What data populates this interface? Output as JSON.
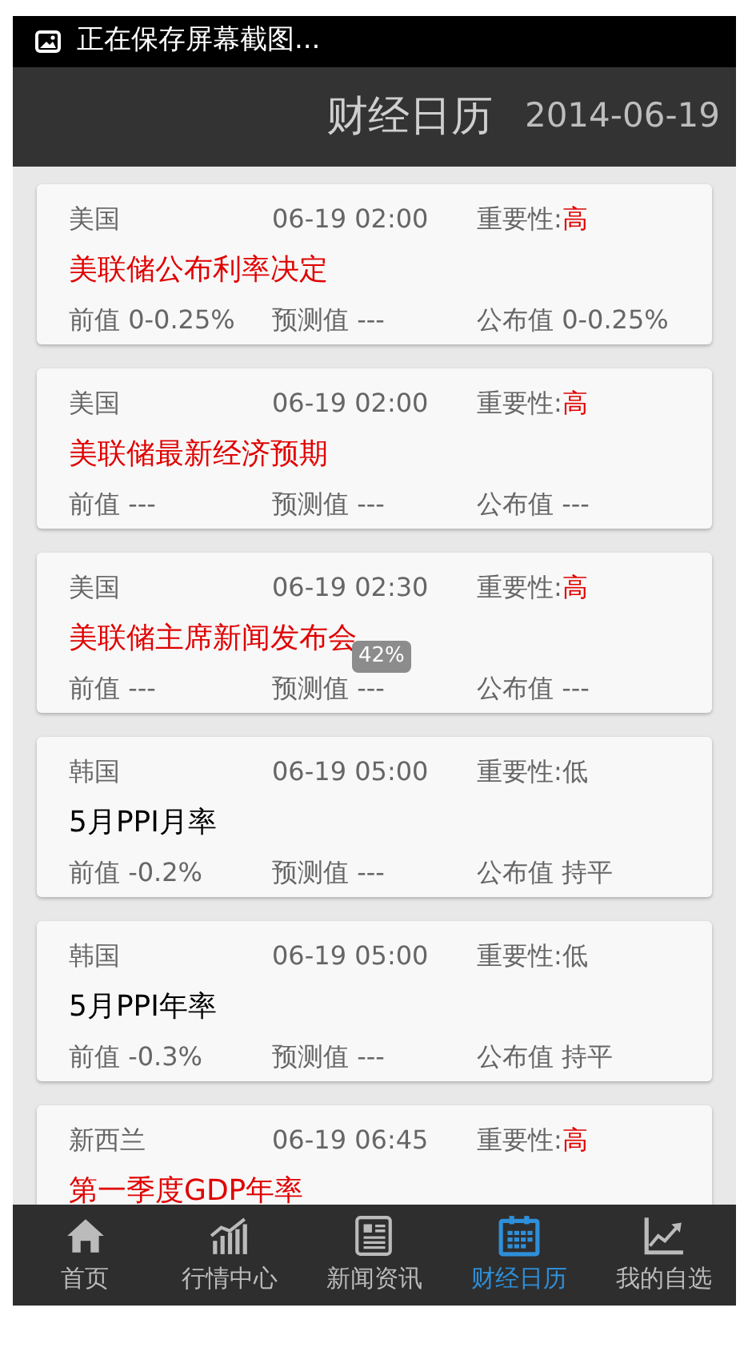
{
  "status_bar": {
    "notification": "正在保存屏幕截图..."
  },
  "header": {
    "title": "财经日历",
    "date": "2014-06-19"
  },
  "events": [
    {
      "country": "美国",
      "time": "06-19 02:00",
      "importance_label": "重要性:",
      "importance": "高",
      "high": true,
      "title": "美联储公布利率决定",
      "previous": "前值 0-0.25%",
      "forecast": "预测值 ---",
      "actual": "公布值 0-0.25%"
    },
    {
      "country": "美国",
      "time": "06-19 02:00",
      "importance_label": "重要性:",
      "importance": "高",
      "high": true,
      "title": "美联储最新经济预期",
      "previous": "前值 ---",
      "forecast": "预测值 ---",
      "actual": "公布值 ---"
    },
    {
      "country": "美国",
      "time": "06-19 02:30",
      "importance_label": "重要性:",
      "importance": "高",
      "high": true,
      "title": "美联储主席新闻发布会",
      "previous": "前值 ---",
      "forecast": "预测值 ---",
      "actual": "公布值 ---"
    },
    {
      "country": "韩国",
      "time": "06-19 05:00",
      "importance_label": "重要性:",
      "importance": "低",
      "high": false,
      "title": "5月PPI月率",
      "previous": "前值 -0.2%",
      "forecast": "预测值 ---",
      "actual": "公布值 持平"
    },
    {
      "country": "韩国",
      "time": "06-19 05:00",
      "importance_label": "重要性:",
      "importance": "低",
      "high": false,
      "title": "5月PPI年率",
      "previous": "前值 -0.3%",
      "forecast": "预测值 ---",
      "actual": "公布值 持平"
    },
    {
      "country": "新西兰",
      "time": "06-19 06:45",
      "importance_label": "重要性:",
      "importance": "高",
      "high": true,
      "title": "第一季度GDP年率"
    }
  ],
  "scroll_badge": "42%",
  "nav": [
    {
      "kind": "home",
      "label": "首页",
      "selected": false
    },
    {
      "kind": "market",
      "label": "行情中心",
      "selected": false
    },
    {
      "kind": "news",
      "label": "新闻资讯",
      "selected": false
    },
    {
      "kind": "calendar",
      "label": "财经日历",
      "selected": true
    },
    {
      "kind": "trend",
      "label": "我的自选",
      "selected": false
    }
  ]
}
